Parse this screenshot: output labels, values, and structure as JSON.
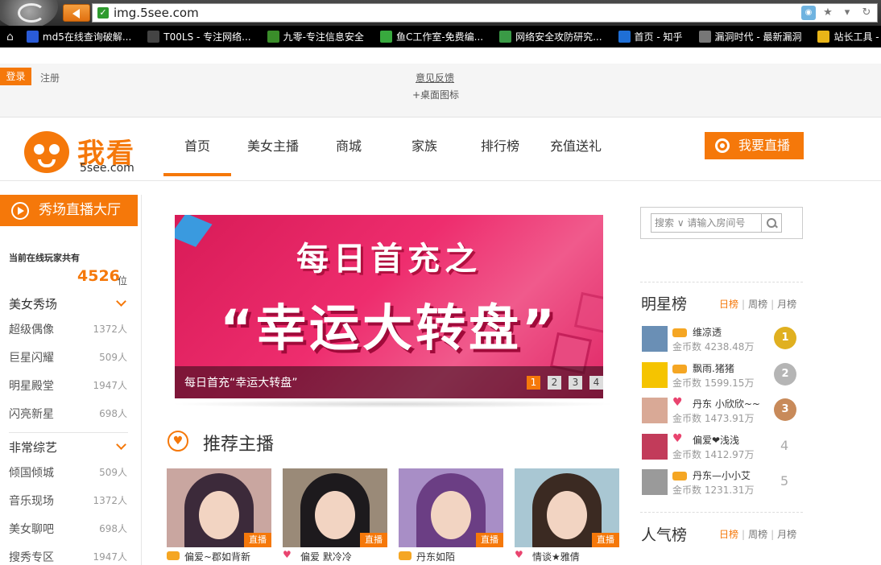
{
  "browser": {
    "url": "img.5see.com",
    "bookmarks": [
      {
        "label": "md5在线查询破解...",
        "icon": "grid-icon",
        "color": "#2a5bd7"
      },
      {
        "label": "T00LS - 专注网络...",
        "icon": "seven-icon",
        "color": "#444444"
      },
      {
        "label": "九零-专注信息安全",
        "icon": "beetle-icon",
        "color": "#3a8d2a"
      },
      {
        "label": "鱼C工作室-免费编...",
        "icon": "c-icon",
        "color": "#38a93e"
      },
      {
        "label": "网络安全攻防研究...",
        "icon": "shield-icon",
        "color": "#3a9a46"
      },
      {
        "label": "首页 - 知乎",
        "icon": "zhihu-icon",
        "color": "#1f6fd6"
      },
      {
        "label": "漏洞时代 - 最新漏洞",
        "icon": "x-icon",
        "color": "#777777"
      },
      {
        "label": "站长工具 -",
        "icon": "bar-icon",
        "color": "#e8b418"
      }
    ]
  },
  "topbar": {
    "login": "登录",
    "register": "注册",
    "feedback": "意见反馈",
    "desktop_icon": "+桌面图标"
  },
  "header": {
    "logo_cn": "我看",
    "logo_en": "5see.com",
    "nav": [
      "首页",
      "美女主播",
      "商城",
      "家族",
      "排行榜",
      "充值送礼"
    ],
    "active_nav": "首页",
    "live_button": "我要直播"
  },
  "sidebar": {
    "hall_button": "秀场直播大厅",
    "online_label": "当前在线玩家共有",
    "online_count": "4526",
    "online_unit": "位",
    "categories": [
      {
        "title": "美女秀场",
        "items": [
          {
            "name": "超级偶像",
            "count": "1372人"
          },
          {
            "name": "巨星闪耀",
            "count": "509人"
          },
          {
            "name": "明星殿堂",
            "count": "1947人"
          },
          {
            "name": "闪亮新星",
            "count": "698人"
          }
        ]
      },
      {
        "title": "非常综艺",
        "items": [
          {
            "name": "倾国倾城",
            "count": "509人"
          },
          {
            "name": "音乐现场",
            "count": "1372人"
          },
          {
            "name": "美女聊吧",
            "count": "698人"
          },
          {
            "name": "搜秀专区",
            "count": "1947人"
          }
        ]
      }
    ]
  },
  "banner": {
    "headline": "每日首充之",
    "main": "“幸运大转盘”",
    "caption": "每日首充“幸运大转盘”",
    "pages": [
      "1",
      "2",
      "3",
      "4"
    ],
    "active_page": "1"
  },
  "recommend": {
    "title": "推荐主播",
    "live_tag": "直播",
    "anchors": [
      {
        "name": "偏爱~郡如背新",
        "badge": "gift",
        "hair": "#3c2a3a",
        "bg": "#c9a6a0"
      },
      {
        "name": "偏爱 默冷冷",
        "badge": "heart",
        "hair": "#1d1a1d",
        "bg": "#9a8a78"
      },
      {
        "name": "丹东如陌",
        "badge": "gift",
        "hair": "#6b3e84",
        "bg": "#a88ec6"
      },
      {
        "name": "情谈★雅倩",
        "badge": "heart",
        "hair": "#3b2a22",
        "bg": "#a9c7d3"
      }
    ]
  },
  "right": {
    "search_placeholder": "搜索 ∨ 请输入房间号",
    "star_rank": {
      "title": "明星榜",
      "tabs": [
        "日榜",
        "周榜",
        "月榜"
      ],
      "rows": [
        {
          "name": "维凉透",
          "coins": "金币数 4238.48万",
          "badge": "gift",
          "rank": "1",
          "medal": "#e0b020",
          "avatar": "#6a8fb5"
        },
        {
          "name": "飘雨.猪猪",
          "coins": "金币数 1599.15万",
          "badge": "gift",
          "rank": "2",
          "medal": "#b5b5b5",
          "avatar": "#f5c400"
        },
        {
          "name": "丹东 小欣欣~~",
          "coins": "金币数 1473.91万",
          "badge": "heart",
          "rank": "3",
          "medal": "#c88a5a",
          "avatar": "#d9a996"
        },
        {
          "name": "偏爱❤浅浅",
          "coins": "金币数 1412.97万",
          "badge": "heart",
          "rank": "4",
          "medal": "",
          "avatar": "#c23b5a"
        },
        {
          "name": "丹东—小小艾",
          "coins": "金币数 1231.31万",
          "badge": "gift",
          "rank": "5",
          "medal": "",
          "avatar": "#9a9a9a"
        }
      ]
    },
    "pop_rank": {
      "title": "人气榜",
      "tabs": [
        "日榜",
        "周榜",
        "月榜"
      ]
    }
  }
}
